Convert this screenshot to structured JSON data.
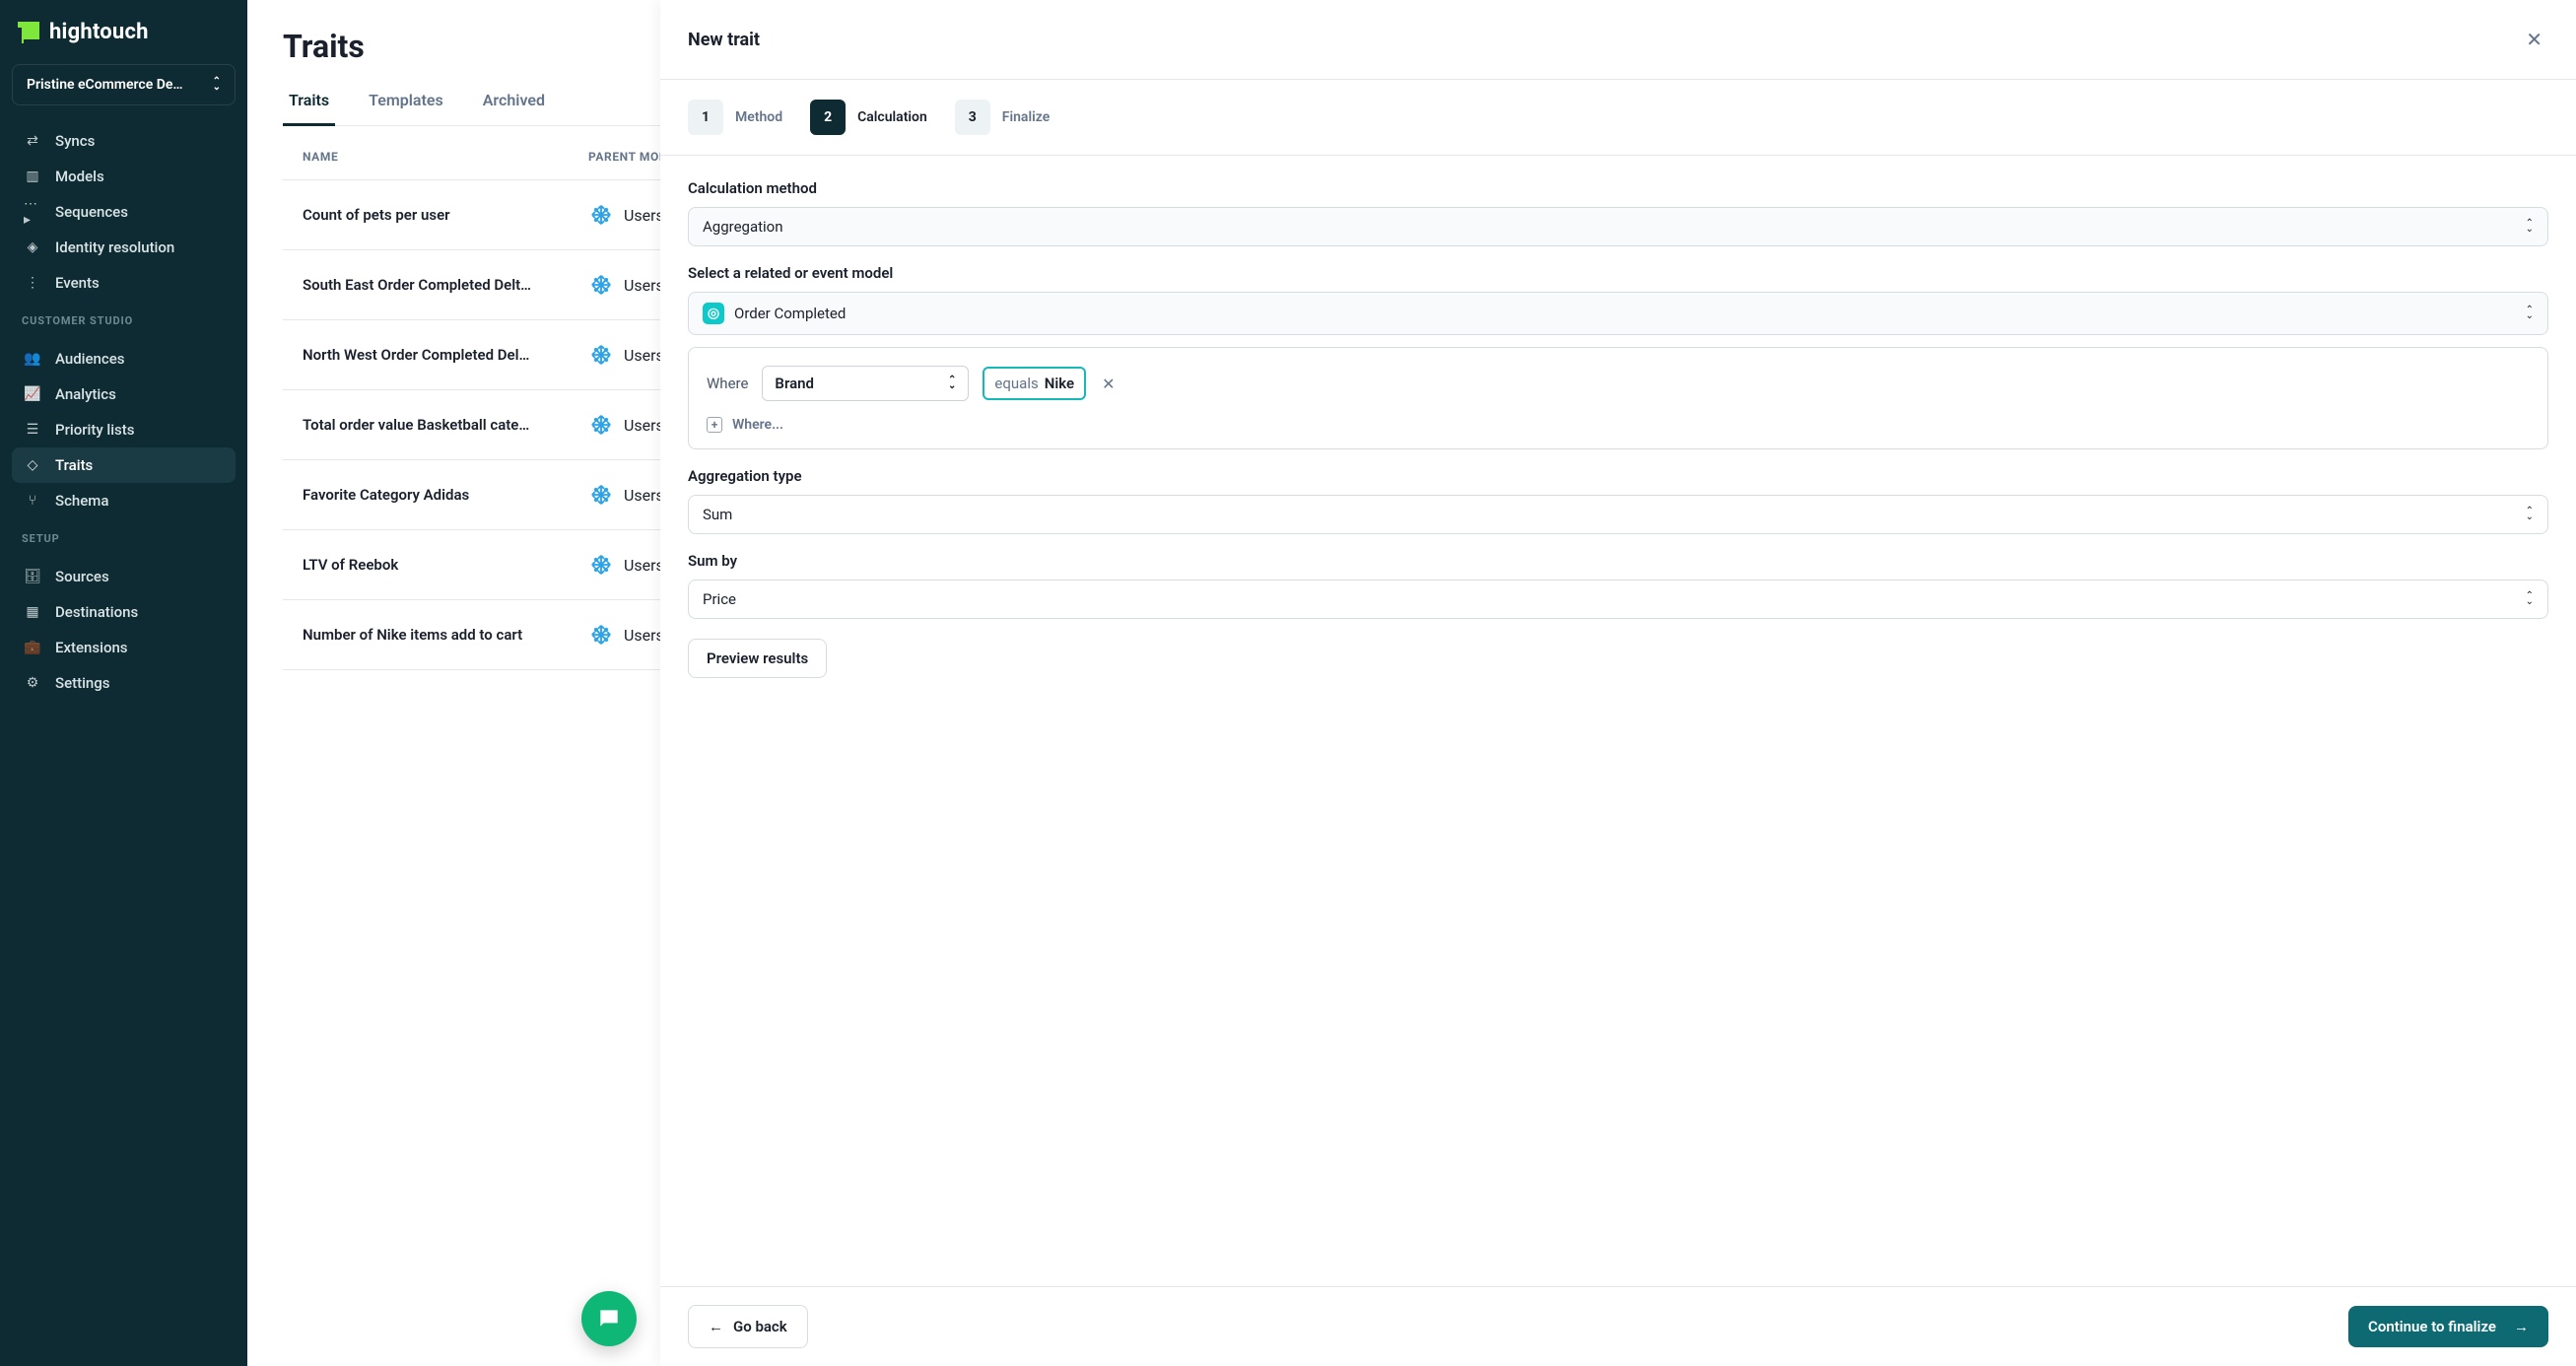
{
  "brand": "hightouch",
  "workspace": "Pristine eCommerce De…",
  "sidebar": {
    "main": [
      {
        "label": "Syncs",
        "icon": "⇄"
      },
      {
        "label": "Models",
        "icon": "▥"
      },
      {
        "label": "Sequences",
        "icon": "⋯▸"
      },
      {
        "label": "Identity resolution",
        "icon": "◈"
      },
      {
        "label": "Events",
        "icon": "⋮"
      }
    ],
    "heading_customer": "CUSTOMER STUDIO",
    "customer": [
      {
        "label": "Audiences",
        "icon": "👥"
      },
      {
        "label": "Analytics",
        "icon": "📈"
      },
      {
        "label": "Priority lists",
        "icon": "☰"
      },
      {
        "label": "Traits",
        "icon": "◇",
        "active": true
      },
      {
        "label": "Schema",
        "icon": "⑂"
      }
    ],
    "heading_setup": "SETUP",
    "setup": [
      {
        "label": "Sources",
        "icon": "🗄"
      },
      {
        "label": "Destinations",
        "icon": "▦"
      },
      {
        "label": "Extensions",
        "icon": "💼"
      },
      {
        "label": "Settings",
        "icon": "⚙"
      }
    ]
  },
  "page": {
    "title": "Traits",
    "tabs": [
      "Traits",
      "Templates",
      "Archived"
    ],
    "active_tab": 0,
    "col_name": "NAME",
    "col_parent": "PARENT MODEL",
    "rows": [
      {
        "name": "Count of pets per user",
        "parent": "Users"
      },
      {
        "name": "South East Order Completed Delt…",
        "parent": "Users"
      },
      {
        "name": "North West Order Completed Del…",
        "parent": "Users"
      },
      {
        "name": "Total order value Basketball cate…",
        "parent": "Users"
      },
      {
        "name": "Favorite Category Adidas",
        "parent": "Users"
      },
      {
        "name": "LTV of Reebok",
        "parent": "Users"
      },
      {
        "name": "Number of Nike items add to cart",
        "parent": "Users"
      }
    ]
  },
  "drawer": {
    "title": "New trait",
    "steps": [
      {
        "num": "1",
        "label": "Method"
      },
      {
        "num": "2",
        "label": "Calculation",
        "active": true
      },
      {
        "num": "3",
        "label": "Finalize"
      }
    ],
    "calc_method_label": "Calculation method",
    "calc_method_value": "Aggregation",
    "model_label": "Select a related or event model",
    "model_value": "Order Completed",
    "where_label": "Where",
    "where_field": "Brand",
    "where_op": "equals",
    "where_value": "Nike",
    "add_where": "Where...",
    "agg_type_label": "Aggregation type",
    "agg_type_value": "Sum",
    "sum_by_label": "Sum by",
    "sum_by_value": "Price",
    "preview": "Preview results",
    "go_back": "Go back",
    "continue": "Continue to finalize"
  }
}
